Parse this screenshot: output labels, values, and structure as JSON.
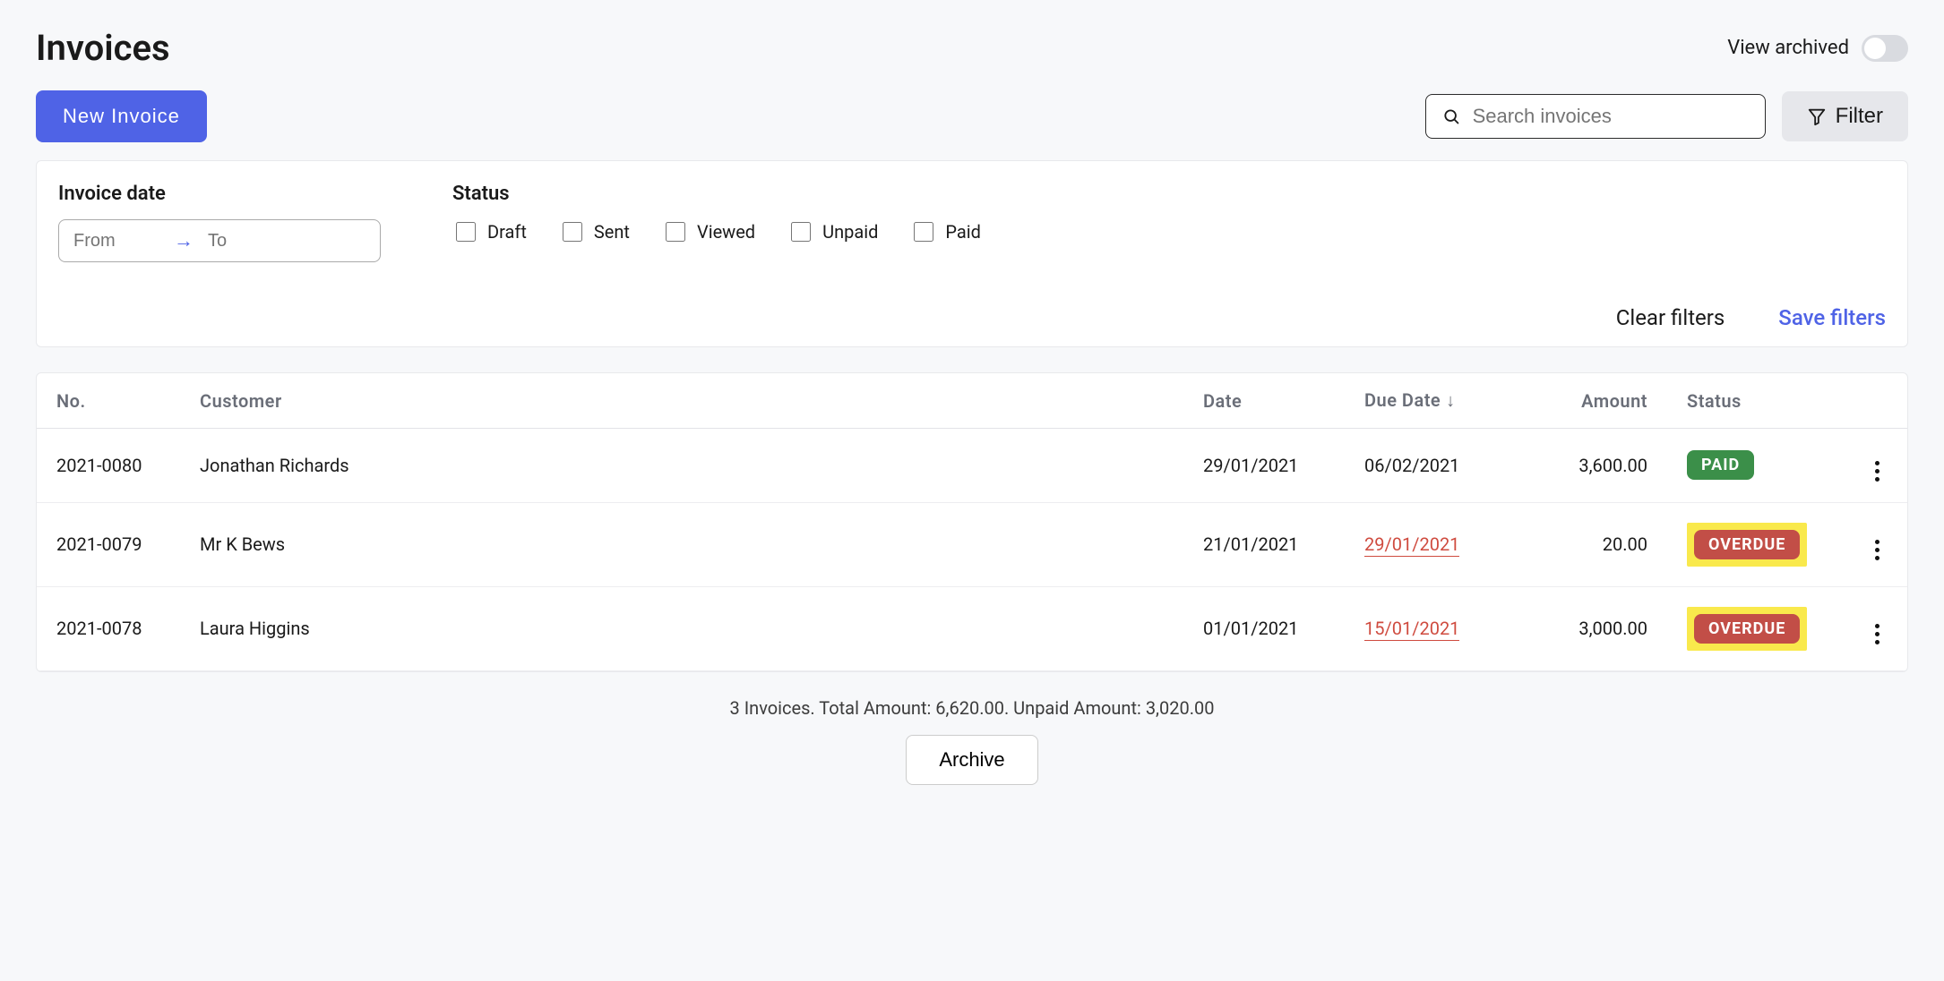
{
  "header": {
    "title": "Invoices",
    "view_archived_label": "View archived"
  },
  "actions": {
    "new_invoice": "New Invoice",
    "search_placeholder": "Search invoices",
    "filter_label": "Filter"
  },
  "filters": {
    "invoice_date_label": "Invoice date",
    "from_placeholder": "From",
    "to_placeholder": "To",
    "status_label": "Status",
    "status_options": {
      "draft": "Draft",
      "sent": "Sent",
      "viewed": "Viewed",
      "unpaid": "Unpaid",
      "paid": "Paid"
    },
    "clear_label": "Clear filters",
    "save_label": "Save filters"
  },
  "table": {
    "headers": {
      "no": "No.",
      "customer": "Customer",
      "date": "Date",
      "due_date": "Due Date",
      "amount": "Amount",
      "status": "Status"
    },
    "rows": [
      {
        "no": "2021-0080",
        "customer": "Jonathan Richards",
        "date": "29/01/2021",
        "due_date": "06/02/2021",
        "due_overdue": false,
        "amount": "3,600.00",
        "status": "PAID",
        "status_kind": "paid",
        "highlight": false
      },
      {
        "no": "2021-0079",
        "customer": "Mr K Bews",
        "date": "21/01/2021",
        "due_date": "29/01/2021",
        "due_overdue": true,
        "amount": "20.00",
        "status": "OVERDUE",
        "status_kind": "overdue",
        "highlight": true
      },
      {
        "no": "2021-0078",
        "customer": "Laura Higgins",
        "date": "01/01/2021",
        "due_date": "15/01/2021",
        "due_overdue": true,
        "amount": "3,000.00",
        "status": "OVERDUE",
        "status_kind": "overdue",
        "highlight": true
      }
    ]
  },
  "summary": "3 Invoices. Total Amount: 6,620.00. Unpaid Amount: 3,020.00",
  "archive_label": "Archive"
}
